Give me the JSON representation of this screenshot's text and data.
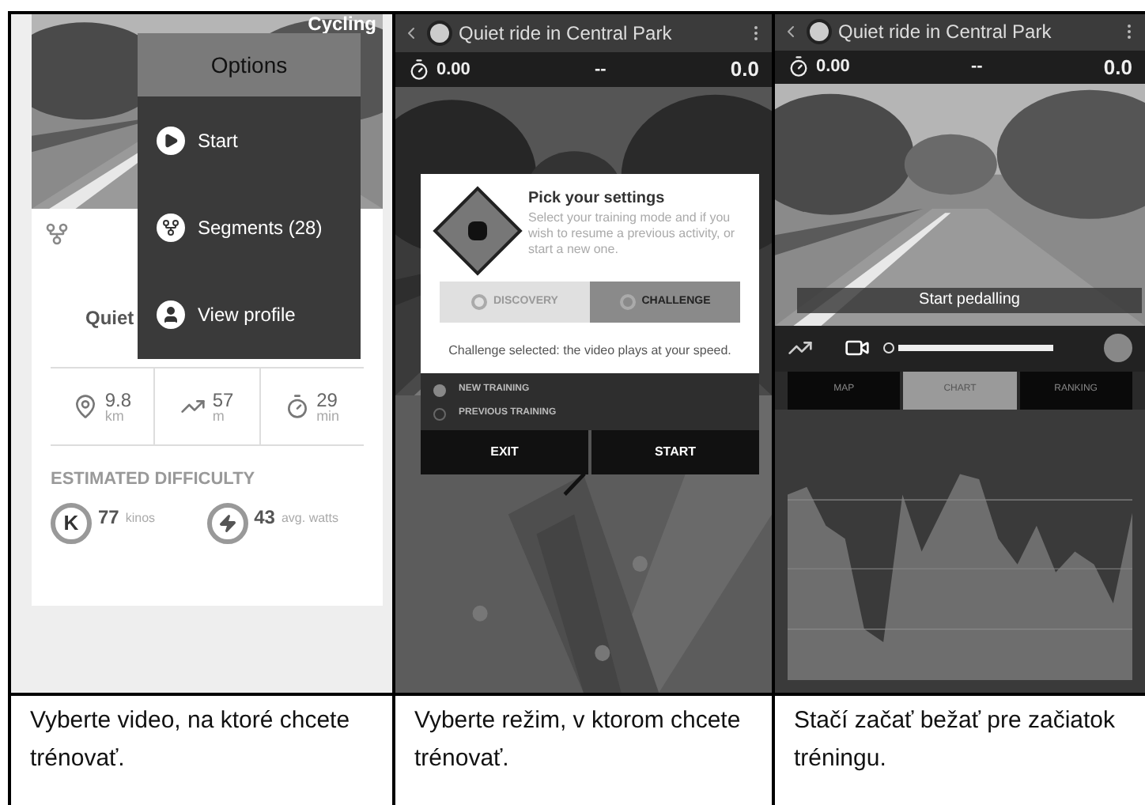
{
  "screens": [
    {
      "kind": "options",
      "corner_label": "Cycling",
      "menu": {
        "title": "Options",
        "items": [
          {
            "kind": "play",
            "label": "Start"
          },
          {
            "kind": "segments",
            "label": "Segments (28)"
          },
          {
            "kind": "profile",
            "label": "View profile"
          }
        ]
      },
      "route_title": "Quiet",
      "stats": [
        {
          "kind": "distance",
          "value": "9.8",
          "unit": "km"
        },
        {
          "kind": "elevation",
          "value": "57",
          "unit": "m"
        },
        {
          "kind": "time",
          "value": "29",
          "unit": "min"
        }
      ],
      "difficulty_title": "ESTIMATED DIFFICULTY",
      "difficulty": [
        {
          "kind": "k",
          "badge": "K",
          "value": "77",
          "unit": "kinos"
        },
        {
          "kind": "power",
          "value": "43",
          "unit": "avg. watts"
        }
      ]
    },
    {
      "kind": "settings",
      "title": "Quiet ride in Central Park",
      "readouts": [
        "0.00",
        "--",
        "0.0"
      ],
      "dialog": {
        "title": "Pick your settings",
        "text": "Select your training mode and if you wish to resume a previous activity, or start a new one.",
        "modes": [
          {
            "label": "DISCOVERY",
            "selected": false
          },
          {
            "label": "CHALLENGE",
            "selected": true
          }
        ],
        "note": "Challenge selected: the video plays at your speed.",
        "options": [
          {
            "label": "NEW TRAINING",
            "selected": true
          },
          {
            "label": "PREVIOUS TRAINING",
            "selected": false
          }
        ],
        "buttons": [
          "EXIT",
          "START"
        ]
      }
    },
    {
      "kind": "ride",
      "title": "Quiet ride in Central Park",
      "readouts": [
        "0.00",
        "--",
        "0.0"
      ],
      "banner": "Start pedalling",
      "tabs": [
        {
          "label": "MAP",
          "selected": false
        },
        {
          "label": "CHART",
          "selected": true
        },
        {
          "label": "RANKING",
          "selected": false
        }
      ]
    }
  ],
  "captions": [
    "Vyberte video, na ktoré chcete trénovať.",
    "Vyberte režim, v ktorom chcete trénovať.",
    "Stačí začať bežať pre začiatok tréningu."
  ]
}
